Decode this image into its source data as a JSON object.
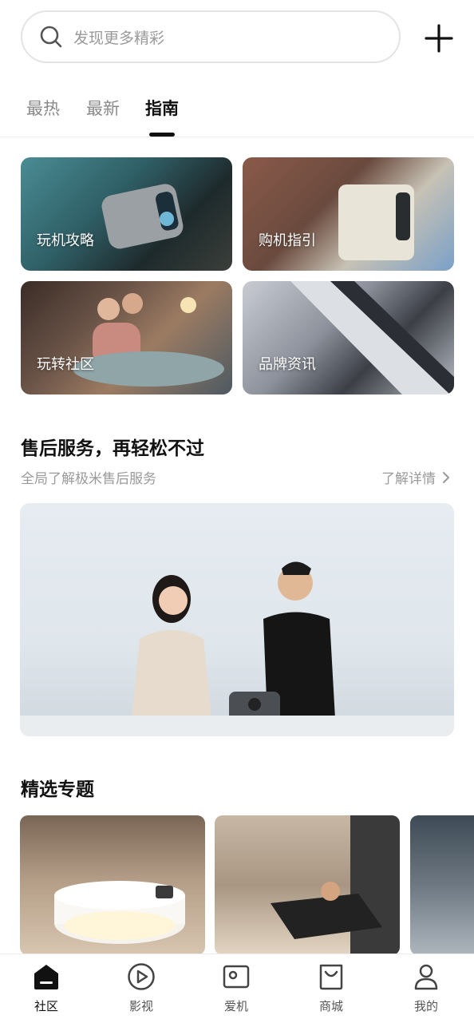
{
  "search": {
    "placeholder": "发现更多精彩"
  },
  "tabs": [
    {
      "label": "最热",
      "active": false
    },
    {
      "label": "最新",
      "active": false
    },
    {
      "label": "指南",
      "active": true
    }
  ],
  "guide_cards": [
    {
      "label": "玩机攻略"
    },
    {
      "label": "购机指引"
    },
    {
      "label": "玩转社区"
    },
    {
      "label": "品牌资讯"
    }
  ],
  "service": {
    "title": "售后服务，再轻松不过",
    "subtitle": "全局了解极米售后服务",
    "more_label": "了解详情"
  },
  "featured": {
    "title": "精选专题"
  },
  "bottom_nav": [
    {
      "label": "社区",
      "icon": "home-icon",
      "active": true
    },
    {
      "label": "影视",
      "icon": "play-icon",
      "active": false
    },
    {
      "label": "爱机",
      "icon": "projector-icon",
      "active": false
    },
    {
      "label": "商城",
      "icon": "shopping-bag-icon",
      "active": false
    },
    {
      "label": "我的",
      "icon": "person-icon",
      "active": false
    }
  ],
  "colors": {
    "accent": "#111111",
    "muted": "#9a9a9a"
  }
}
